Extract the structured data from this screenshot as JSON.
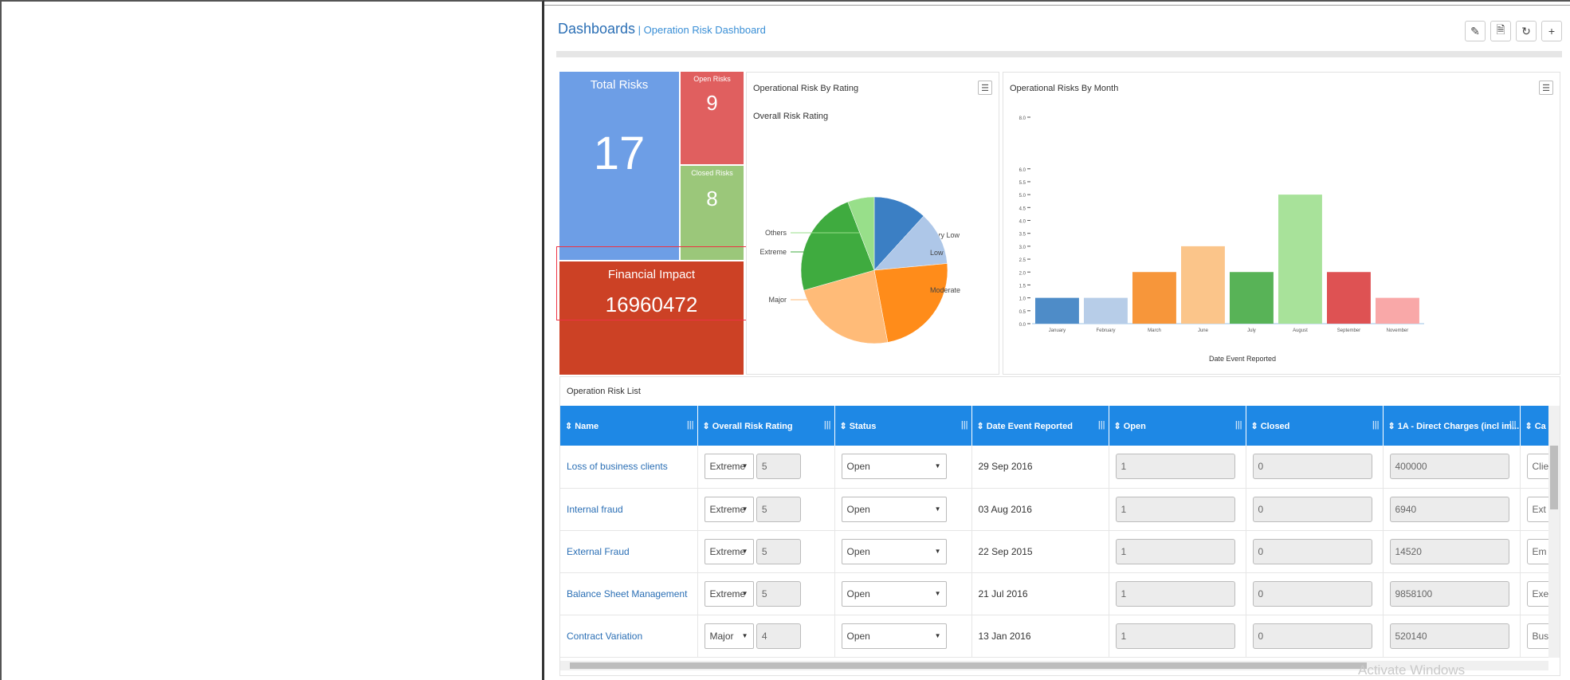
{
  "header": {
    "title": "Dashboards",
    "separator": " | ",
    "subtitle": "Operation Risk Dashboard"
  },
  "toolbar": {
    "edit_icon": "pencil-icon",
    "pdf_icon": "pdf-icon",
    "refresh_icon": "refresh-icon",
    "add_icon": "plus-icon"
  },
  "tiles": {
    "total": {
      "label": "Total Risks",
      "value": "17"
    },
    "open": {
      "label": "Open Risks",
      "value": "9"
    },
    "closed": {
      "label": "Closed Risks",
      "value": "8"
    },
    "financial": {
      "label": "Financial Impact",
      "value": "16960472"
    }
  },
  "pie_panel": {
    "title": "Operational Risk By Rating",
    "chart_title": "Overall Risk Rating"
  },
  "bar_panel": {
    "title": "Operational Risks By Month"
  },
  "chart_data": [
    {
      "type": "pie",
      "title": "Overall Risk Rating",
      "categories": [
        "Very Low",
        "Low",
        "Moderate",
        "Major",
        "Extreme",
        "Others"
      ],
      "values": [
        2,
        2,
        4,
        4,
        4,
        1
      ],
      "colors": [
        "#3b7fc4",
        "#aec7e8",
        "#ff8c1a",
        "#ffbb78",
        "#3fab3f",
        "#98df8a"
      ]
    },
    {
      "type": "bar",
      "xlabel": "Date Event Reported",
      "ylabel": "",
      "ylim": [
        0,
        8
      ],
      "yticks": [
        "0.0",
        "0.5",
        "1.0",
        "1.5",
        "2.0",
        "2.5",
        "3.0",
        "3.5",
        "4.0",
        "4.5",
        "5.0",
        "5.5",
        "6.0"
      ],
      "categories": [
        "January",
        "February",
        "March",
        "June",
        "July",
        "August",
        "September",
        "November"
      ],
      "values": [
        1,
        1,
        2,
        3,
        2,
        5,
        2,
        1
      ],
      "colors": [
        "#4e8cc8",
        "#b7cde8",
        "#f7963a",
        "#fbc58a",
        "#58b357",
        "#a8e29a",
        "#de5253",
        "#f9a8a8"
      ],
      "top_tick": "8.0"
    }
  ],
  "list": {
    "title": "Operation Risk List",
    "columns": [
      "Name",
      "Overall Risk Rating",
      "Status",
      "Date Event Reported",
      "Open",
      "Closed",
      "1A - Direct Charges (incl im...",
      "Ca"
    ],
    "rows": [
      {
        "name": "Loss of business clients",
        "rating": "Extreme",
        "rating_num": "5",
        "status": "Open",
        "date": "29 Sep 2016",
        "open": "1",
        "closed": "0",
        "charges": "400000",
        "cat": "Clie"
      },
      {
        "name": "Internal fraud",
        "rating": "Extreme",
        "rating_num": "5",
        "status": "Open",
        "date": "03 Aug 2016",
        "open": "1",
        "closed": "0",
        "charges": "6940",
        "cat": "Ext"
      },
      {
        "name": "External Fraud",
        "rating": "Extreme",
        "rating_num": "5",
        "status": "Open",
        "date": "22 Sep 2015",
        "open": "1",
        "closed": "0",
        "charges": "14520",
        "cat": "Em"
      },
      {
        "name": "Balance Sheet Management",
        "rating": "Extreme",
        "rating_num": "5",
        "status": "Open",
        "date": "21 Jul 2016",
        "open": "1",
        "closed": "0",
        "charges": "9858100",
        "cat": "Exe"
      },
      {
        "name": "Contract Variation",
        "rating": "Major",
        "rating_num": "4",
        "status": "Open",
        "date": "13 Jan 2016",
        "open": "1",
        "closed": "0",
        "charges": "520140",
        "cat": "Bus"
      }
    ]
  },
  "watermark": "Activate Windows"
}
